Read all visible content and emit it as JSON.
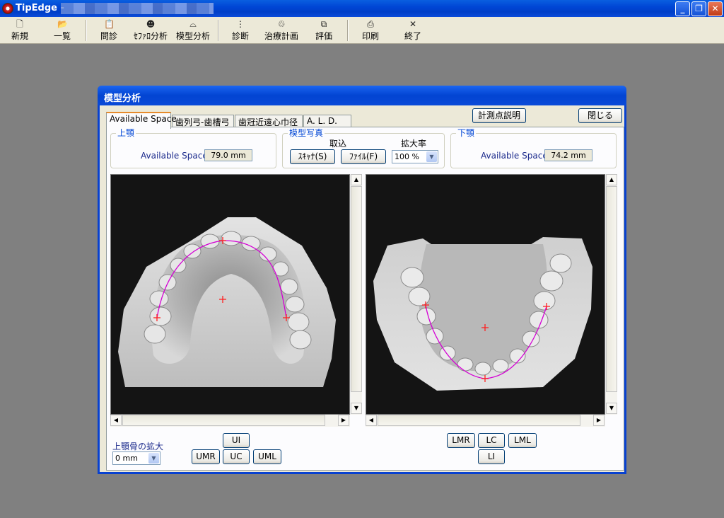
{
  "window": {
    "app_title": "TipEdge -",
    "minimize_glyph": "_",
    "maximize_glyph": "❐",
    "close_glyph": "✕"
  },
  "toolbar": {
    "items": [
      {
        "label": "新規",
        "icon": "new-file-icon",
        "glyph": "🗋"
      },
      {
        "label": "一覧",
        "icon": "open-folder-icon",
        "glyph": "📂"
      },
      {
        "label": "問診",
        "icon": "questionnaire-icon",
        "glyph": "📋"
      },
      {
        "label": "ｾﾌｧﾛ分析",
        "icon": "cephalo-analysis-icon",
        "glyph": "☻"
      },
      {
        "label": "模型分析",
        "icon": "model-analysis-icon",
        "glyph": "⌓"
      },
      {
        "label": "診断",
        "icon": "diagnosis-icon",
        "glyph": "⋮"
      },
      {
        "label": "治療計画",
        "icon": "treatment-plan-icon",
        "glyph": "♲"
      },
      {
        "label": "評価",
        "icon": "evaluation-icon",
        "glyph": "⧉"
      },
      {
        "label": "印刷",
        "icon": "print-icon",
        "glyph": "⎙"
      },
      {
        "label": "終了",
        "icon": "exit-icon",
        "glyph": "✕"
      }
    ]
  },
  "dialog": {
    "title": "模型分析",
    "tabs": [
      {
        "label": "Available Space"
      },
      {
        "label": "歯列弓-歯槽弓"
      },
      {
        "label": "歯冠近遠心巾径"
      },
      {
        "label": "A. L. D."
      }
    ],
    "measure_button": "計測点説明",
    "close_button": "閉じる",
    "upper_group": {
      "legend": "上顎",
      "field_label": "Available Space",
      "value": "79.0 mm"
    },
    "photo_group": {
      "legend": "模型写真",
      "capture_label": "取込",
      "zoom_label": "拡大率",
      "scanner_button": "ｽｷｬﾅ(S)",
      "file_button": "ﾌｧｲﾙ(F)",
      "zoom_value": "100 %"
    },
    "lower_group": {
      "legend": "下顎",
      "field_label": "Available Space",
      "value": "74.2 mm"
    },
    "upper_bone": {
      "label": "上顎骨の拡大",
      "value": "0 mm"
    },
    "upper_buttons": {
      "ui": "UI",
      "umr": "UMR",
      "uc": "UC",
      "uml": "UML"
    },
    "lower_buttons": {
      "lmr": "LMR",
      "lc": "LC",
      "lml": "LML",
      "li": "LI"
    }
  }
}
